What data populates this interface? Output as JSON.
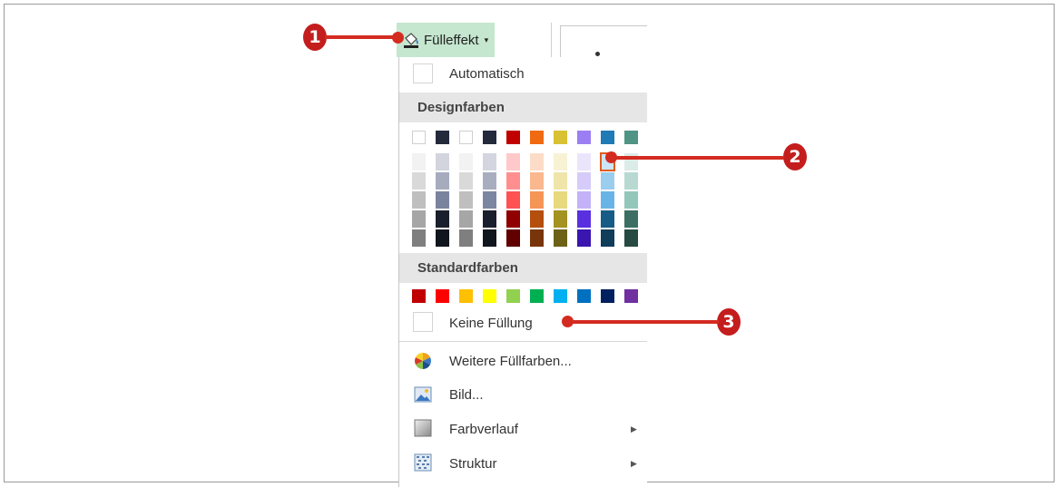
{
  "ribbon": {
    "button_label": "Fülleffekt",
    "icon": "paint-bucket-icon"
  },
  "menu": {
    "automatic_label": "Automatisch",
    "theme_colors_heading": "Designfarben",
    "standard_colors_heading": "Standardfarben",
    "no_fill_label": "Keine Füllung",
    "more_colors_label": "Weitere Füllfarben...",
    "picture_label": "Bild...",
    "gradient_label": "Farbverlauf",
    "texture_label": "Struktur"
  },
  "theme_colors": [
    {
      "base": "#ffffff",
      "shades": [
        "#f2f2f2",
        "#d9d9d9",
        "#bfbfbf",
        "#a6a6a6",
        "#7f7f7f"
      ]
    },
    {
      "base": "#232a3c",
      "shades": [
        "#d2d5de",
        "#a6acbe",
        "#7a839e",
        "#1a1f2d",
        "#11151e"
      ]
    },
    {
      "base": "#ffffff",
      "shades": [
        "#f2f2f2",
        "#d9d9d9",
        "#bfbfbf",
        "#a6a6a6",
        "#7f7f7f"
      ]
    },
    {
      "base": "#232a3c",
      "shades": [
        "#d3d6e0",
        "#a8aec0",
        "#7d86a1",
        "#1a1f2d",
        "#11151e"
      ]
    },
    {
      "base": "#c00000",
      "shades": [
        "#ffc9c9",
        "#ff8f8f",
        "#ff5252",
        "#900000",
        "#600000"
      ]
    },
    {
      "base": "#f06a12",
      "shades": [
        "#fcdcc7",
        "#f9b88e",
        "#f59556",
        "#b44f0d",
        "#783509"
      ]
    },
    {
      "base": "#d8c233",
      "shades": [
        "#f7f2d4",
        "#efe5aa",
        "#e8d97f",
        "#a49221",
        "#6d6116"
      ]
    },
    {
      "base": "#9b7ff2",
      "shades": [
        "#ebe5fc",
        "#d7ccf9",
        "#c3b2f7",
        "#5a2fe0",
        "#3a15b0"
      ]
    },
    {
      "base": "#1f7ab5",
      "shades": [
        "#cde6f7",
        "#9bcdef",
        "#69b4e6",
        "#175b87",
        "#0f3d5a"
      ]
    },
    {
      "base": "#4f9484",
      "shades": [
        "#dbece8",
        "#b7d9d1",
        "#93c7ba",
        "#3b6f63",
        "#274a42"
      ]
    }
  ],
  "standard_colors": [
    "#c00000",
    "#ff0000",
    "#ffc000",
    "#ffff00",
    "#92d050",
    "#00b050",
    "#00b0f0",
    "#0070c0",
    "#002060",
    "#7030a0"
  ],
  "callouts": [
    "1",
    "2",
    "3"
  ]
}
